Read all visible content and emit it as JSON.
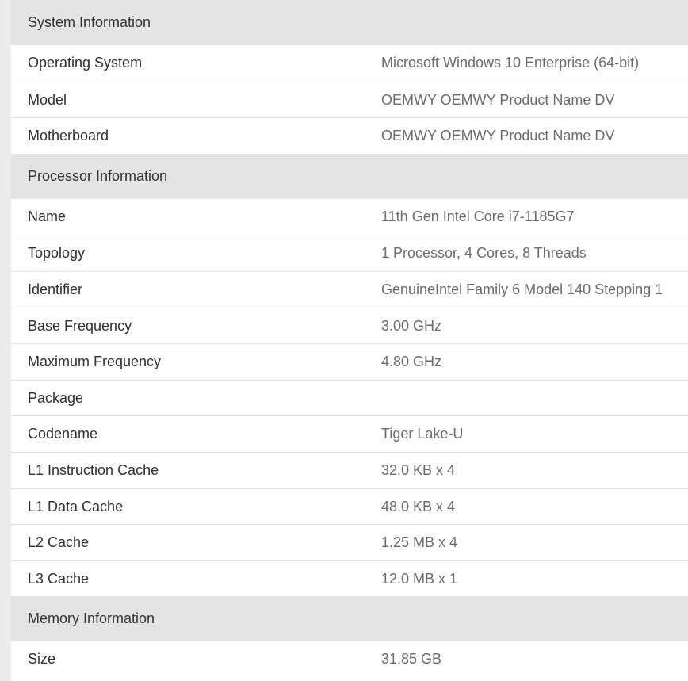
{
  "sections": [
    {
      "title": "System Information",
      "rows": [
        {
          "label": "Operating System",
          "value": "Microsoft Windows 10 Enterprise (64-bit)"
        },
        {
          "label": "Model",
          "value": "OEMWY OEMWY Product Name DV"
        },
        {
          "label": "Motherboard",
          "value": "OEMWY OEMWY Product Name DV"
        }
      ]
    },
    {
      "title": "Processor Information",
      "rows": [
        {
          "label": "Name",
          "value": "11th Gen Intel Core i7-1185G7"
        },
        {
          "label": "Topology",
          "value": "1 Processor, 4 Cores, 8 Threads"
        },
        {
          "label": "Identifier",
          "value": "GenuineIntel Family 6 Model 140 Stepping 1"
        },
        {
          "label": "Base Frequency",
          "value": "3.00 GHz"
        },
        {
          "label": "Maximum Frequency",
          "value": "4.80 GHz"
        },
        {
          "label": "Package",
          "value": ""
        },
        {
          "label": "Codename",
          "value": "Tiger Lake-U"
        },
        {
          "label": "L1 Instruction Cache",
          "value": "32.0 KB x 4"
        },
        {
          "label": "L1 Data Cache",
          "value": "48.0 KB x 4"
        },
        {
          "label": "L2 Cache",
          "value": "1.25 MB x 4"
        },
        {
          "label": "L3 Cache",
          "value": "12.0 MB x 1"
        }
      ]
    },
    {
      "title": "Memory Information",
      "rows": [
        {
          "label": "Size",
          "value": "31.85 GB"
        }
      ]
    }
  ]
}
